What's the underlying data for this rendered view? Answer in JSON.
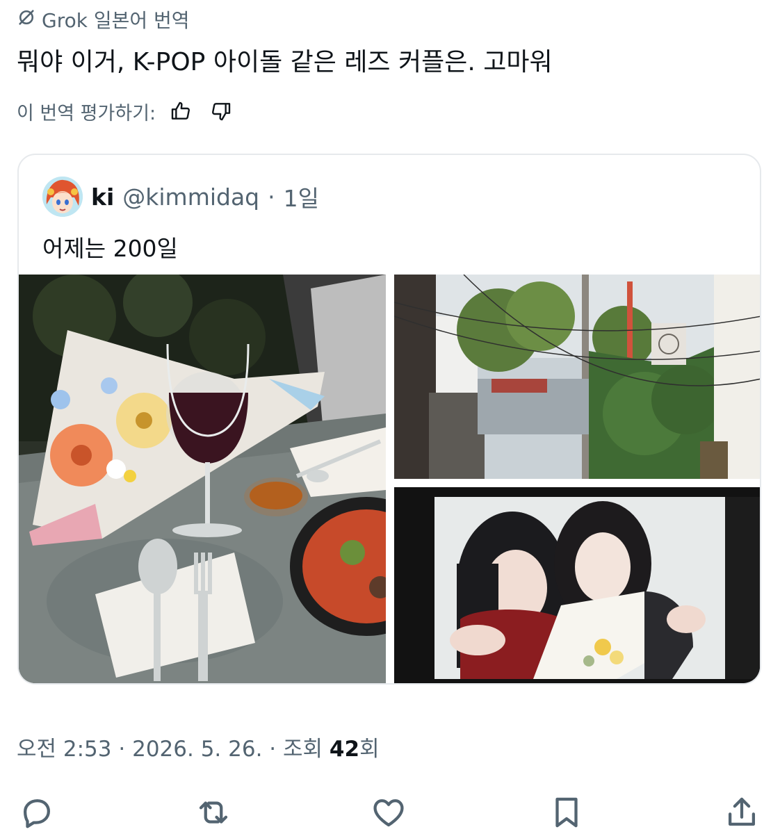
{
  "translation": {
    "provider_line": "Grok 일본어 번역",
    "icon": "translate-slash-icon"
  },
  "tweet": {
    "text": "뭐야 이거, K-POP 아이돌 같은 레즈 커플은. 고마워"
  },
  "rating": {
    "label": "이 번역 평가하기:",
    "icons": [
      "thumbs-up-icon",
      "thumbs-down-icon"
    ]
  },
  "quote": {
    "author_name": "ki",
    "handle": "@kimmidaq",
    "separator": "·",
    "age": "1일",
    "text": "어제는 200일",
    "photos": [
      "flowers-and-wine-dinner-photo",
      "alley-street-photo",
      "two-girls-photo-booth-photo"
    ]
  },
  "meta": {
    "time": "오전 2:53",
    "sep1": "·",
    "date": "2026. 5. 26.",
    "sep2": "·",
    "views_label": "조회",
    "views_count": "42",
    "views_suffix": "회"
  },
  "actions": [
    "reply-icon",
    "retweet-icon",
    "like-icon",
    "bookmark-icon",
    "share-icon"
  ],
  "colors": {
    "text": "#0f1419",
    "secondary": "#536471",
    "border": "#e6e9ec"
  }
}
